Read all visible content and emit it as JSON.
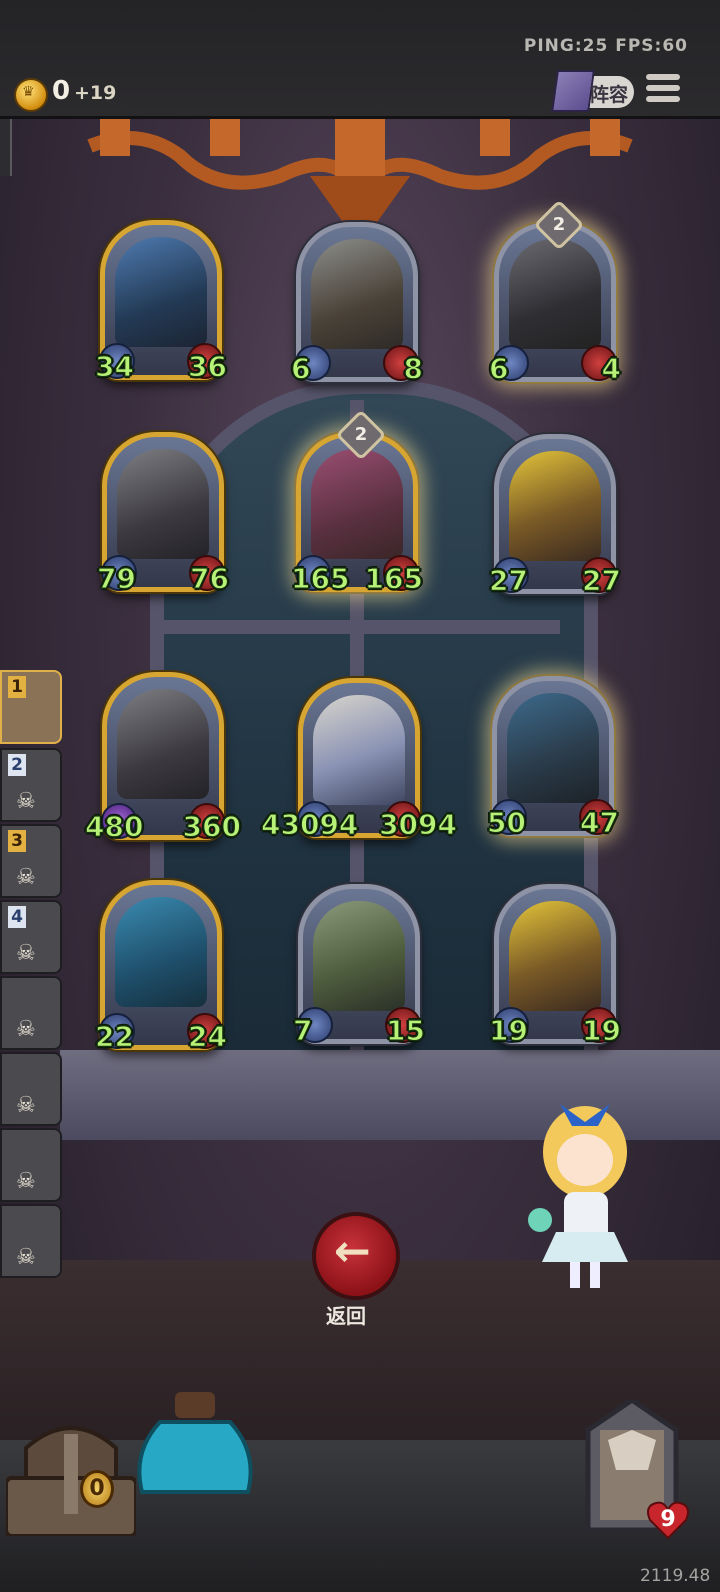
{
  "topbar": {
    "ping_fps": "PING:25   FPS:60",
    "gold": "0",
    "gold_income": "+19",
    "lineup_label": "阵容",
    "icons": [
      "coin-icon",
      "book-icon",
      "menu-icon"
    ]
  },
  "board": {
    "cards": [
      {
        "atk": "34",
        "hp": "36"
      },
      {
        "atk": "6",
        "hp": "8"
      },
      {
        "atk": "6",
        "hp": "4",
        "level": "2"
      },
      {
        "atk": "79",
        "hp": "76"
      },
      {
        "atk": "165",
        "hp": "165",
        "level": "2"
      },
      {
        "atk": "27",
        "hp": "27"
      },
      {
        "atk": "480",
        "hp": "360"
      },
      {
        "atk": "43094",
        "hp": "3094"
      },
      {
        "atk": "50",
        "hp": "47"
      },
      {
        "atk": "22",
        "hp": "24"
      },
      {
        "atk": "7",
        "hp": "15"
      },
      {
        "atk": "19",
        "hp": "19"
      }
    ]
  },
  "side_list": {
    "items": [
      {
        "rank": "1"
      },
      {
        "rank": "2"
      },
      {
        "rank": "3"
      },
      {
        "rank": "4"
      },
      {
        "rank": ""
      },
      {
        "rank": ""
      },
      {
        "rank": ""
      },
      {
        "rank": ""
      }
    ]
  },
  "controls": {
    "back_label": "返回",
    "back_icon": "arrow-left-icon"
  },
  "bottom": {
    "chest_count": "0",
    "hero_health": "9",
    "coords": "2119.48"
  },
  "colors": {
    "stat_green": "#b7f277",
    "gold_frame": "#d7a531",
    "silver_frame": "#8f93a6",
    "back_button_red": "#c8323a"
  }
}
